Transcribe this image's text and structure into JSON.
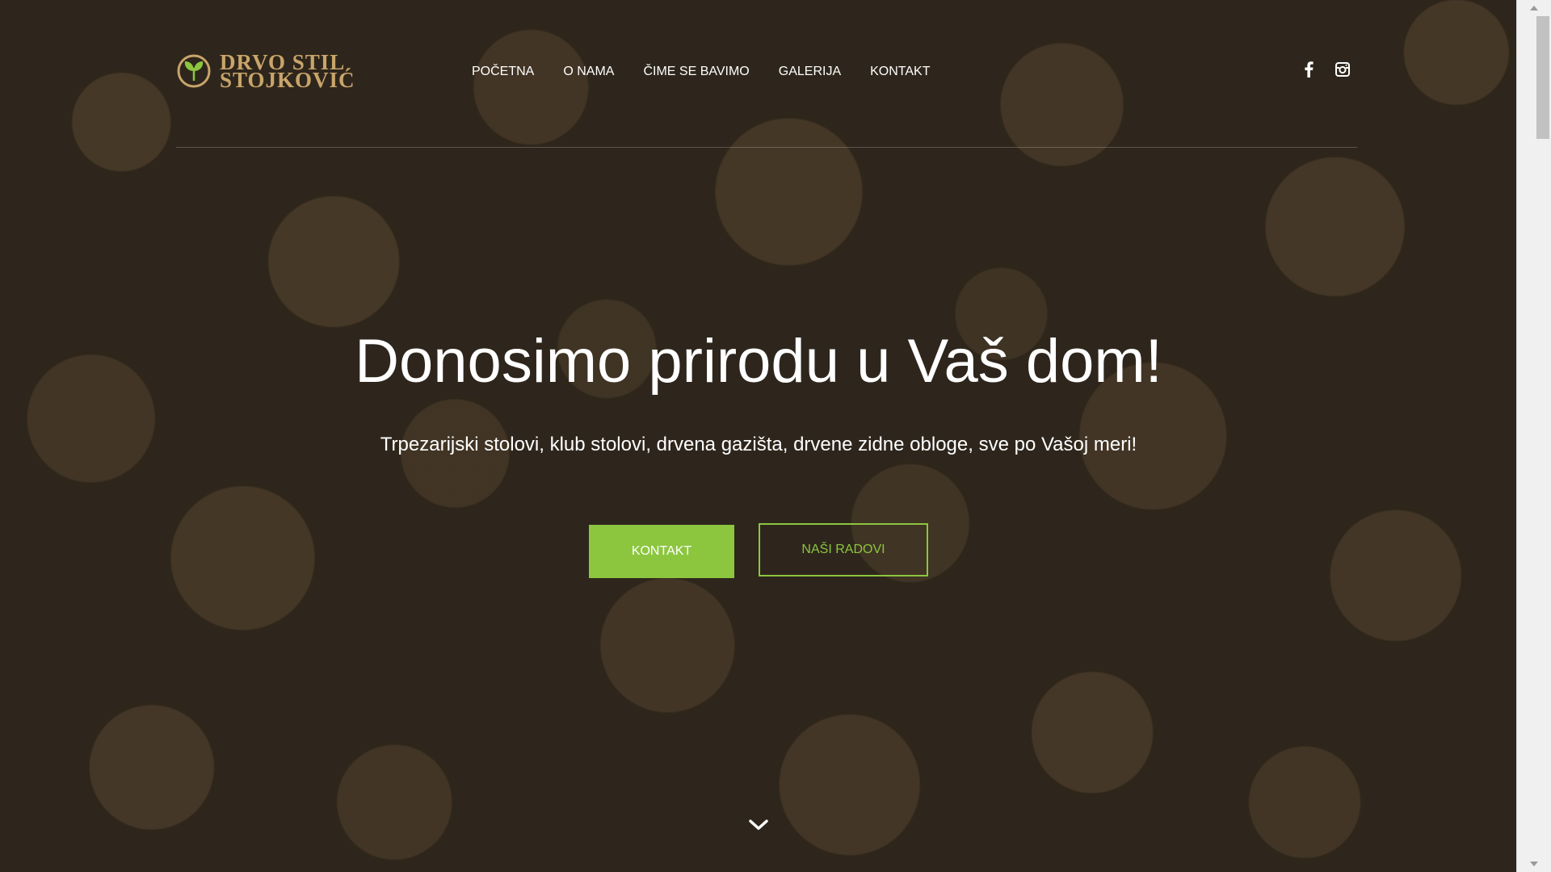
{
  "brand": {
    "line1": "DRVO STIL",
    "line2": "STOJKOVIĆ",
    "accent_color": "#c9a56a"
  },
  "nav": {
    "items": [
      {
        "label": "POČETNA"
      },
      {
        "label": "O NAMA"
      },
      {
        "label": "ČIME SE BAVIMO"
      },
      {
        "label": "GALERIJA"
      },
      {
        "label": "KONTAKT"
      }
    ]
  },
  "social": {
    "icons": [
      "facebook-icon",
      "instagram-icon"
    ]
  },
  "hero": {
    "title": "Donosimo prirodu u Vaš dom!",
    "subtitle": "Trpezarijski stolovi, klub stolovi, drvena gazišta, drvene zidne obloge, sve po Vašoj meri!",
    "primary_button": "KONTAKT",
    "secondary_button": "NAŠI RADOVI",
    "button_color": "#8cc63f"
  },
  "scroll": {
    "icon": "chevron-down-icon"
  }
}
